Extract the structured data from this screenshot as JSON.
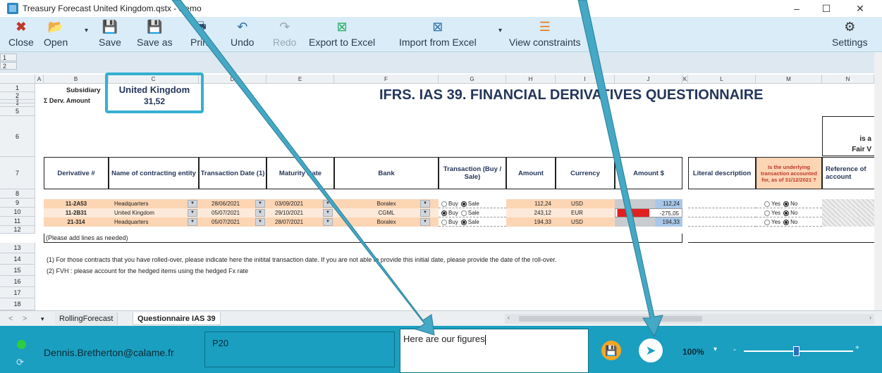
{
  "window": {
    "title": "Treasury Forecast United Kingdom.qstx - Demo"
  },
  "toolbar": {
    "close": "Close",
    "open": "Open",
    "save": "Save",
    "save_as": "Save as",
    "print": "Print",
    "undo": "Undo",
    "redo": "Redo",
    "export_excel": "Export to Excel",
    "import_excel": "Import from Excel",
    "view_constraints": "View constraints",
    "settings": "Settings"
  },
  "outline": {
    "levels": [
      "1",
      "2"
    ]
  },
  "columns": [
    "A",
    "B",
    "C",
    "D",
    "E",
    "F",
    "G",
    "H",
    "I",
    "J",
    "K",
    "L",
    "M",
    "N"
  ],
  "rows": [
    "1",
    "2",
    "3",
    "4",
    "5",
    "6",
    "7",
    "8",
    "9",
    "10",
    "11",
    "12",
    "13",
    "14",
    "15",
    "16",
    "17",
    "18"
  ],
  "sheet": {
    "subsidiary_label": "Subsidiary",
    "subsidiary_value": "United Kingdom",
    "deriv_amount_label": "Σ Derv. Amount",
    "deriv_amount_value": "31,52",
    "report_title": "IFRS. IAS 39. FINANCIAL DERIVATIVES QUESTIONNAIRE",
    "partial_header_line1": "is a",
    "partial_header_line2": "Fair V",
    "headers": {
      "derivative": "Derivative #",
      "contracting_entity": "Name of contracting entity",
      "transaction_date": "Transaction Date (1)",
      "maturity_date": "Maturity Date",
      "bank": "Bank",
      "transaction": "Transaction (Buy / Sale)",
      "amount": "Amount",
      "currency": "Currency",
      "amount_usd": "Amount $",
      "literal_description": "Literal description",
      "underlying_question": "Is the underlying transaction accounted for, as of 31/12/2021 ?",
      "reference_account": "Reference of account"
    },
    "data_rows": [
      {
        "derivative": "11-2A53",
        "entity": "Headquarters",
        "trans_date": "28/06/2021",
        "maturity": "03/09/2021",
        "bank": "Boralex",
        "buy_label": "Buy",
        "sale_label": "Sale",
        "buy_selected": false,
        "amount": "112,24",
        "currency": "USD",
        "amount_usd": "112,24",
        "yes_label": "Yes",
        "no_label": "No",
        "yes_selected": false
      },
      {
        "derivative": "11-2B31",
        "entity": "United Kingdom",
        "trans_date": "05/07/2021",
        "maturity": "29/10/2021",
        "bank": "CGML",
        "buy_label": "Buy",
        "sale_label": "Sale",
        "buy_selected": true,
        "amount": "243,12",
        "currency": "EUR",
        "amount_usd": "-275,05",
        "yes_label": "Yes",
        "no_label": "No",
        "yes_selected": false
      },
      {
        "derivative": "21-314",
        "entity": "Headquarters",
        "trans_date": "05/07/2021",
        "maturity": "28/07/2021",
        "bank": "Boralex",
        "buy_label": "Buy",
        "sale_label": "Sale",
        "buy_selected": false,
        "amount": "194,33",
        "currency": "USD",
        "amount_usd": "194,33",
        "yes_label": "Yes",
        "no_label": "No",
        "yes_selected": false
      }
    ],
    "add_lines_note": "(Please add lines as needed)",
    "footnote1": "(1) For those contracts that you have rolled-over, please indicate here the initital transaction date. If you are not able to provide this initial date, please provide the date of the roll-over.",
    "footnote2": "(2) FVH : please account for the hedged items using the hedged Fx rate"
  },
  "sheet_tabs": {
    "nav_prev": "<",
    "nav_next": ">",
    "tabs": [
      "RollingForecast",
      "Questionnaire IAS 39"
    ],
    "active": 1
  },
  "bottom": {
    "user_email": "Dennis.Bretherton@calame.fr",
    "cell_ref": "P20",
    "message": "Here are our figures",
    "zoom": "100%",
    "zoom_level": 0.45,
    "accent": "#1a9fc0",
    "save_color": "#f5a623",
    "status_dot": "#2ecc40"
  }
}
